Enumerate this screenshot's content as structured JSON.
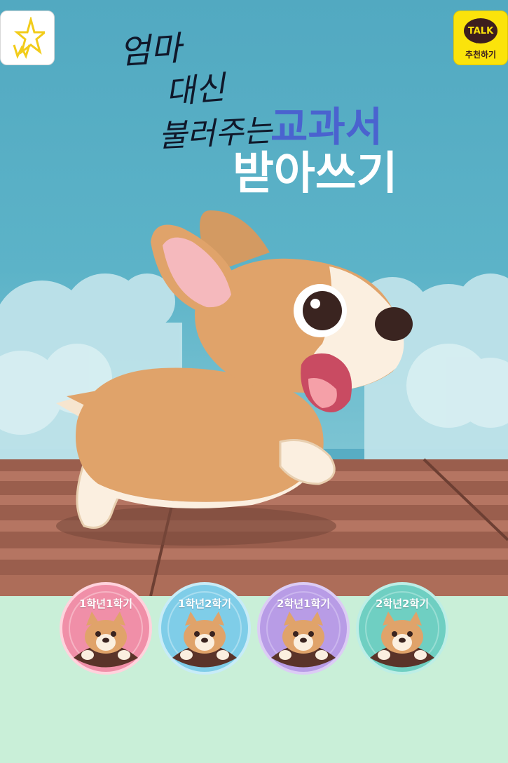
{
  "header": {
    "home_icon": "star-w-logo-icon",
    "kakao": {
      "bubble_text": "TALK",
      "label": "추천하기",
      "color": "#fbe30b"
    }
  },
  "title": {
    "line1": "엄마",
    "line2": "대신",
    "line3": "불러주는",
    "highlight": "교과서",
    "main": "받아쓰기",
    "highlight_color": "#4a63cf"
  },
  "grades": [
    {
      "label": "1학년1학기",
      "color": "#f08fa8"
    },
    {
      "label": "1학년2학기",
      "color": "#7fcde8"
    },
    {
      "label": "2학년1학기",
      "color": "#b89ce6"
    },
    {
      "label": "2학년2학기",
      "color": "#6fcfc2"
    }
  ]
}
